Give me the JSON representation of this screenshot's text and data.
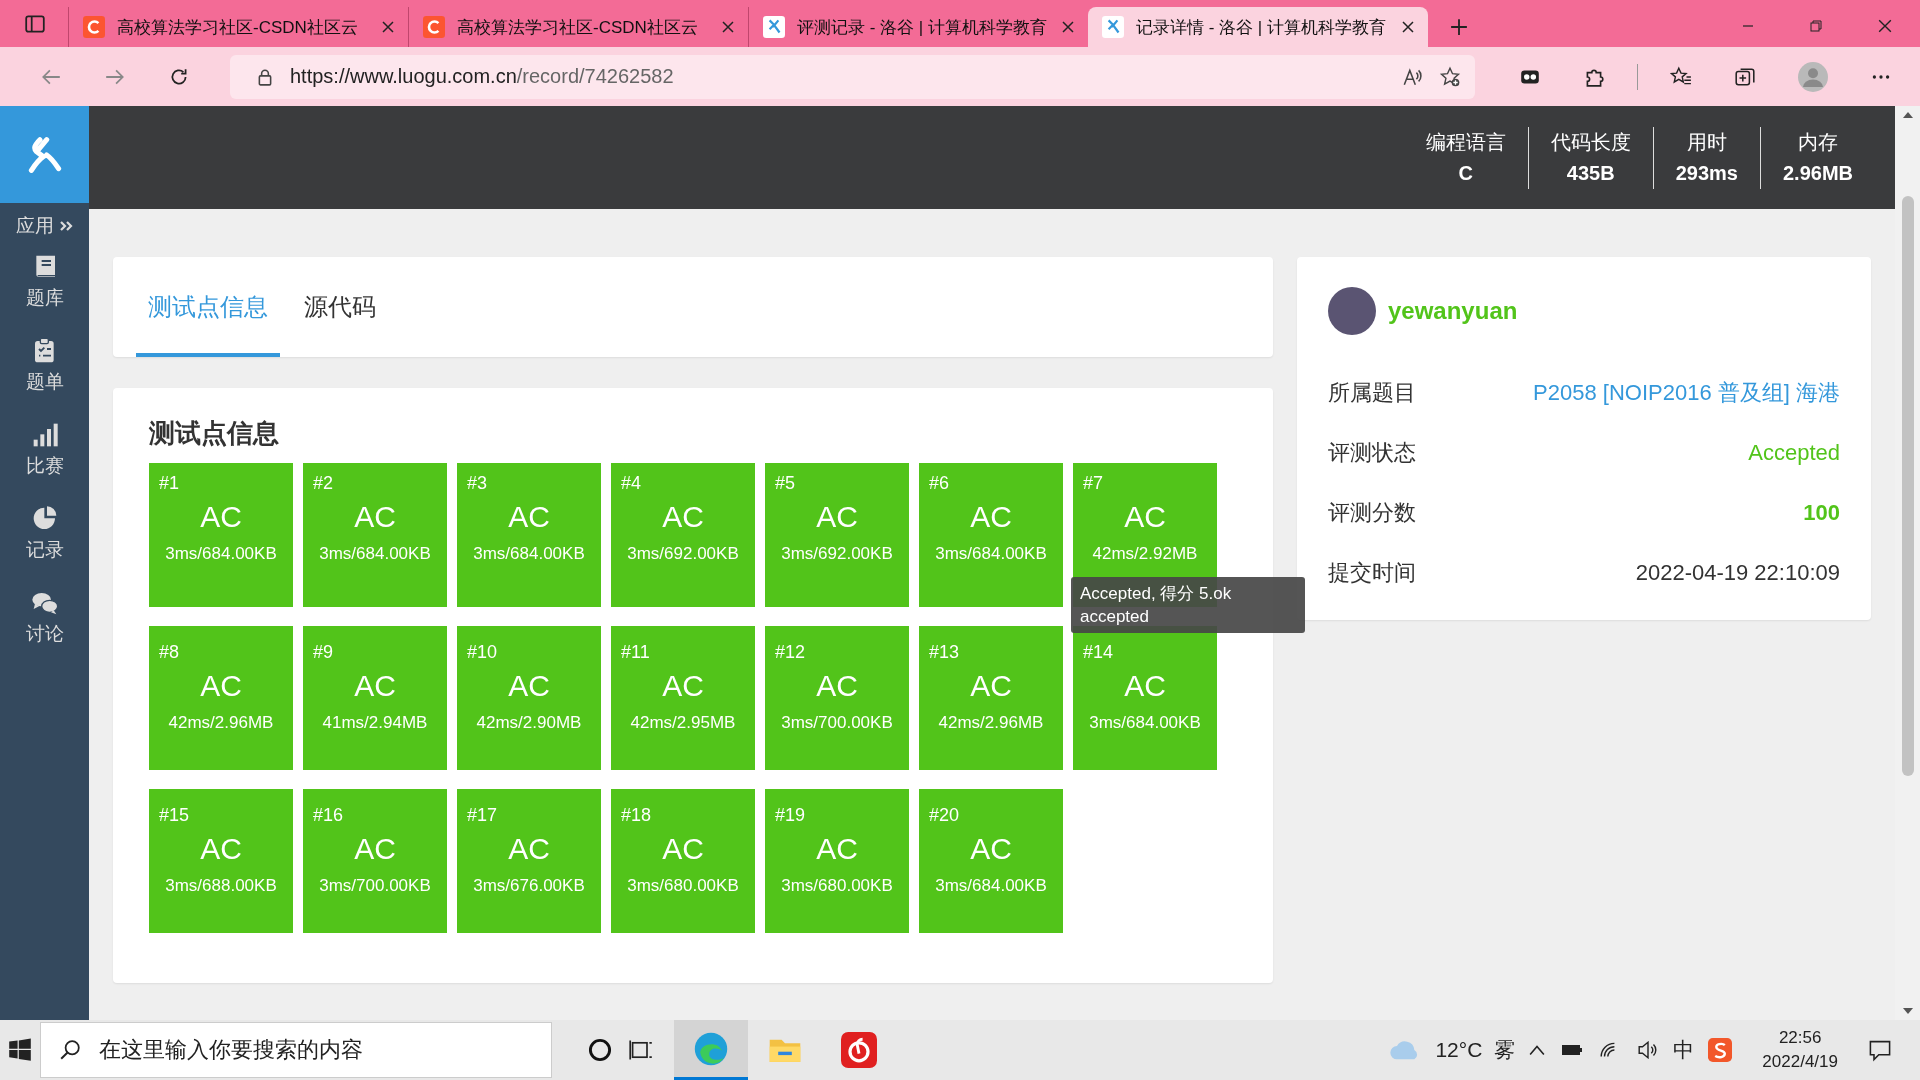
{
  "browser": {
    "tabs": [
      {
        "title": "高校算法学习社区-CSDN社区云",
        "kind": "csdn",
        "selected": false
      },
      {
        "title": "高校算法学习社区-CSDN社区云",
        "kind": "csdn",
        "selected": false
      },
      {
        "title": "评测记录 - 洛谷 | 计算机科学教育",
        "kind": "luogu",
        "selected": false
      },
      {
        "title": "记录详情 - 洛谷 | 计算机科学教育",
        "kind": "luogu",
        "selected": true
      }
    ],
    "url_host": "https://www.luogu.com.cn",
    "url_path": "/record/74262582"
  },
  "sidebar": {
    "apps_label": "应用",
    "items": [
      {
        "label": "题库",
        "kind": "book"
      },
      {
        "label": "题单",
        "kind": "clipboard"
      },
      {
        "label": "比赛",
        "kind": "bars"
      },
      {
        "label": "记录",
        "kind": "pie"
      },
      {
        "label": "讨论",
        "kind": "chat"
      }
    ]
  },
  "header_stats": [
    {
      "label": "编程语言",
      "value": "C"
    },
    {
      "label": "代码长度",
      "value": "435B"
    },
    {
      "label": "用时",
      "value": "293ms"
    },
    {
      "label": "内存",
      "value": "2.96MB"
    }
  ],
  "record_tabs": [
    {
      "label": "测试点信息",
      "selected": true
    },
    {
      "label": "源代码",
      "selected": false
    }
  ],
  "testcases": {
    "title": "测试点信息",
    "cases": [
      {
        "id": "#1",
        "status": "AC",
        "detail": "3ms/684.00KB"
      },
      {
        "id": "#2",
        "status": "AC",
        "detail": "3ms/684.00KB"
      },
      {
        "id": "#3",
        "status": "AC",
        "detail": "3ms/684.00KB"
      },
      {
        "id": "#4",
        "status": "AC",
        "detail": "3ms/692.00KB"
      },
      {
        "id": "#5",
        "status": "AC",
        "detail": "3ms/692.00KB"
      },
      {
        "id": "#6",
        "status": "AC",
        "detail": "3ms/684.00KB"
      },
      {
        "id": "#7",
        "status": "AC",
        "detail": "42ms/2.92MB"
      },
      {
        "id": "#8",
        "status": "AC",
        "detail": "42ms/2.96MB"
      },
      {
        "id": "#9",
        "status": "AC",
        "detail": "41ms/2.94MB"
      },
      {
        "id": "#10",
        "status": "AC",
        "detail": "42ms/2.90MB"
      },
      {
        "id": "#11",
        "status": "AC",
        "detail": "42ms/2.95MB"
      },
      {
        "id": "#12",
        "status": "AC",
        "detail": "3ms/700.00KB"
      },
      {
        "id": "#13",
        "status": "AC",
        "detail": "42ms/2.96MB"
      },
      {
        "id": "#14",
        "status": "AC",
        "detail": "3ms/684.00KB"
      },
      {
        "id": "#15",
        "status": "AC",
        "detail": "3ms/688.00KB"
      },
      {
        "id": "#16",
        "status": "AC",
        "detail": "3ms/700.00KB"
      },
      {
        "id": "#17",
        "status": "AC",
        "detail": "3ms/676.00KB"
      },
      {
        "id": "#18",
        "status": "AC",
        "detail": "3ms/680.00KB"
      },
      {
        "id": "#19",
        "status": "AC",
        "detail": "3ms/680.00KB"
      },
      {
        "id": "#20",
        "status": "AC",
        "detail": "3ms/684.00KB"
      }
    ]
  },
  "tooltip": {
    "lines": [
      "Accepted, 得分 5.ok",
      "accepted"
    ]
  },
  "record_info": {
    "username": "yewanyuan",
    "rows": [
      {
        "label": "所属题目",
        "value": "P2058 [NOIP2016 普及组] 海港",
        "kind": "link"
      },
      {
        "label": "评测状态",
        "value": "Accepted",
        "kind": "status"
      },
      {
        "label": "评测分数",
        "value": "100",
        "kind": "score"
      },
      {
        "label": "提交时间",
        "value": "2022-04-19 22:10:09",
        "kind": "text"
      }
    ]
  },
  "taskbar": {
    "search_placeholder": "在这里输入你要搜索的内容",
    "temperature": "12°C",
    "weather": "雾",
    "ime": "中",
    "time": "22:56",
    "date": "2022/4/19"
  }
}
